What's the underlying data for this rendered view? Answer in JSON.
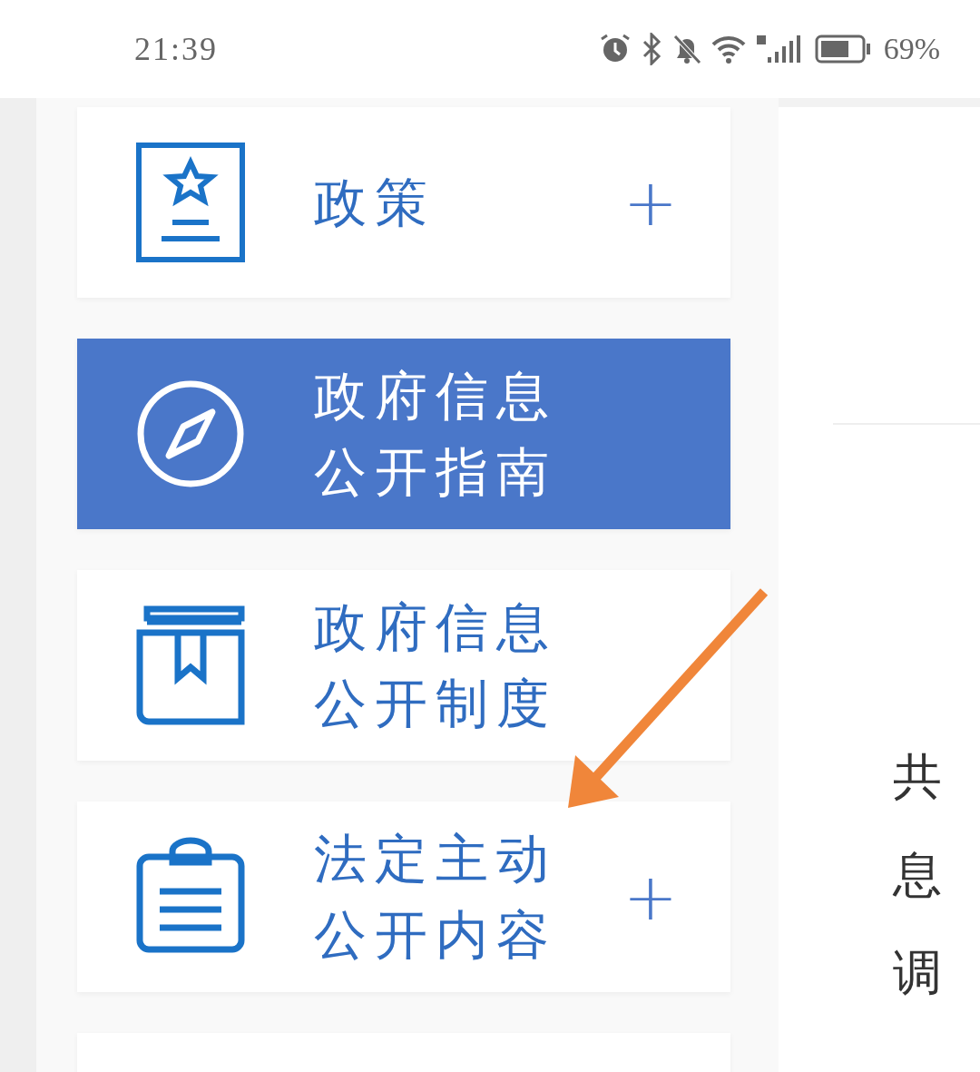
{
  "status_bar": {
    "time": "21:39",
    "battery": "69%"
  },
  "menu_items": [
    {
      "kind": "award",
      "label": "政策",
      "expandable": true,
      "selected": false
    },
    {
      "kind": "compass",
      "label": "政府信息公开指南",
      "expandable": false,
      "selected": true
    },
    {
      "kind": "book",
      "label": "政府信息公开制度",
      "expandable": false,
      "selected": false
    },
    {
      "kind": "clipboard",
      "label": "法定主动公开内容",
      "expandable": true,
      "selected": false
    },
    {
      "kind": "cut",
      "selected": false
    }
  ],
  "expand_symbol": "+",
  "document": {
    "lines": [
      "共",
      "息",
      "调"
    ]
  }
}
